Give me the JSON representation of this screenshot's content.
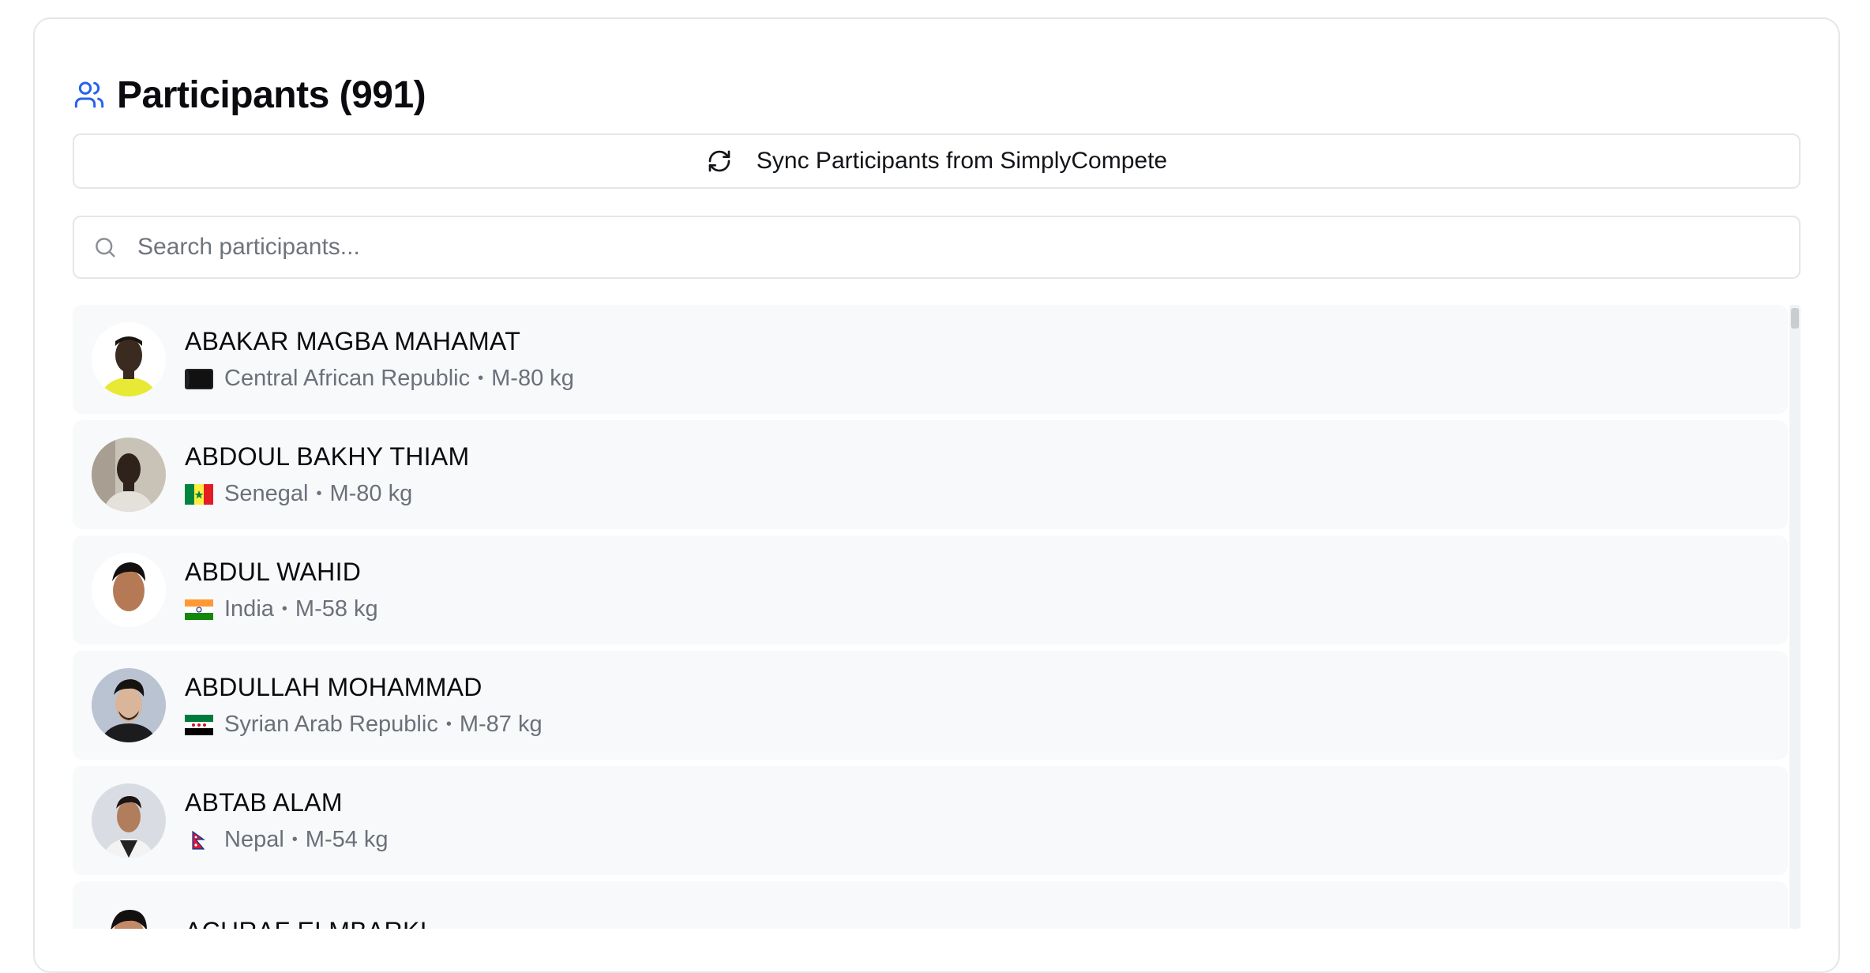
{
  "panel": {
    "title": "Participants (991)",
    "sync_label": "Sync Participants from SimplyCompete",
    "search_placeholder": "Search participants..."
  },
  "participants": [
    {
      "name": "ABAKAR MAGBA MAHAMAT",
      "country": "Central African Republic",
      "category": "M-80 kg",
      "flag": "flag-central-african-republic"
    },
    {
      "name": "ABDOUL BAKHY THIAM",
      "country": "Senegal",
      "category": "M-80 kg",
      "flag": "flag-senegal"
    },
    {
      "name": "ABDUL WAHID",
      "country": "India",
      "category": "M-58 kg",
      "flag": "flag-india"
    },
    {
      "name": "ABDULLAH MOHAMMAD",
      "country": "Syrian Arab Republic",
      "category": "M-87 kg",
      "flag": "flag-syria"
    },
    {
      "name": "ABTAB ALAM",
      "country": "Nepal",
      "category": "M-54 kg",
      "flag": "flag-nepal"
    },
    {
      "name": "ACHRAF ELMBARKI",
      "country": "",
      "category": "",
      "flag": ""
    }
  ],
  "separator": "•",
  "colors": {
    "accent": "#2563eb",
    "row_bg": "#f8f9fb",
    "border": "#e4e6ea",
    "muted_text": "#6b7079"
  },
  "icons": {
    "header": "users-icon",
    "sync": "refresh-icon",
    "search": "search-icon"
  }
}
